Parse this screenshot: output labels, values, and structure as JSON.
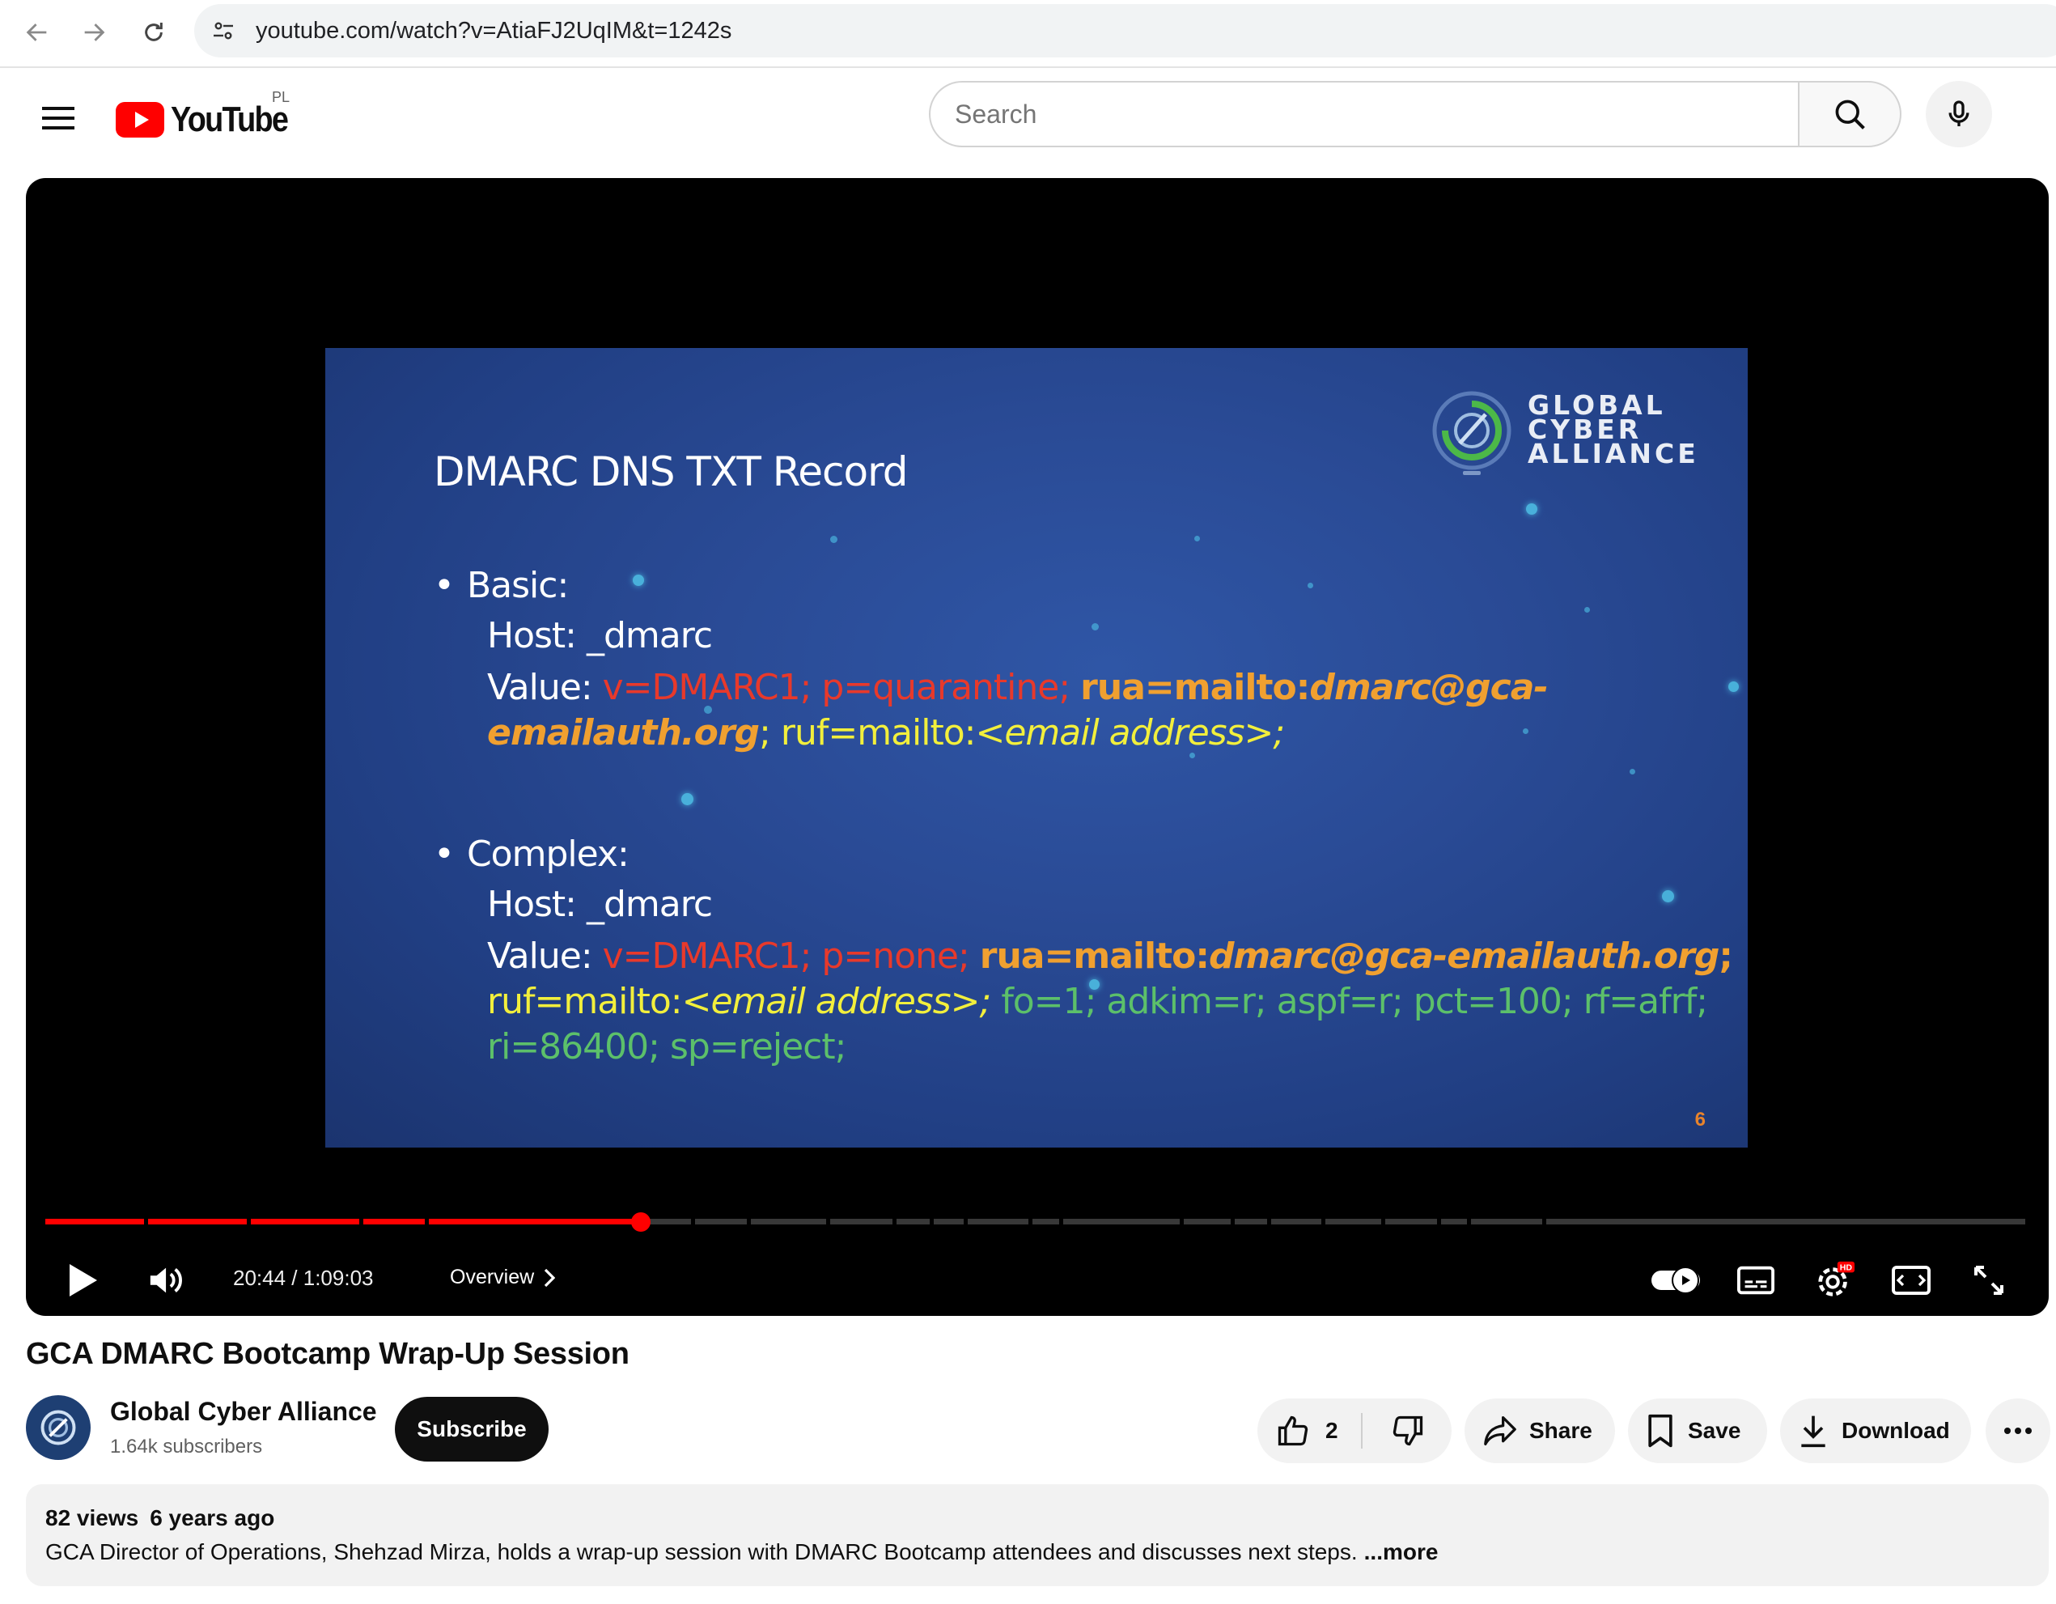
{
  "browser": {
    "url": "youtube.com/watch?v=AtiaFJ2UqIM&t=1242s"
  },
  "header": {
    "logo_text": "YouTube",
    "country_code": "PL",
    "search_placeholder": "Search"
  },
  "slide": {
    "title": "DMARC DNS TXT Record",
    "logo_lines": [
      "GLOBAL",
      "CYBER",
      "ALLIANCE"
    ],
    "basic": {
      "heading": "Basic:",
      "host": "Host: _dmarc",
      "value_label": "Value: ",
      "v": "v=DMARC1; ",
      "p": "p=quarantine; ",
      "rua_key": "rua=mailto:",
      "rua_addr_1": "dmarc@gca-",
      "rua_addr_2": "emailauth.org",
      "sep": "; ",
      "ruf_key": "ruf=mailto:",
      "ruf_addr": "<email address>;"
    },
    "complex": {
      "heading": "Complex:",
      "host": "Host: _dmarc",
      "value_label": "Value: ",
      "v": "v=DMARC1; ",
      "p": "p=none; ",
      "rua_key": "rua=mailto:",
      "rua_addr": "dmarc@gca-emailauth.org",
      "rua_end": ";",
      "ruf_key": "ruf=mailto:",
      "ruf_addr": "<email address>;",
      "tags_1": " fo=1; adkim=r; aspf=r; pct=100; rf=afrf;",
      "tags_2": "ri=86400; sp=reject;"
    },
    "page_number": "6"
  },
  "player": {
    "time_current": "20:44",
    "time_sep": " / ",
    "time_total": "1:09:03",
    "progress_fraction": 0.3,
    "chapter": "Overview",
    "accent_color": "#ff0000",
    "hd_badge": "HD"
  },
  "video": {
    "title": "GCA DMARC Bootcamp Wrap-Up Session",
    "channel_name": "Global Cyber Alliance",
    "channel_subs": "1.64k subscribers",
    "subscribe_label": "Subscribe",
    "like_count": "2",
    "share_label": "Share",
    "save_label": "Save",
    "download_label": "Download"
  },
  "description": {
    "views": "82 views",
    "age": "6 years ago",
    "text": "GCA Director of Operations, Shehzad Mirza, holds a wrap-up session with DMARC Bootcamp attendees and discusses next steps.",
    "more_label": "...more"
  }
}
